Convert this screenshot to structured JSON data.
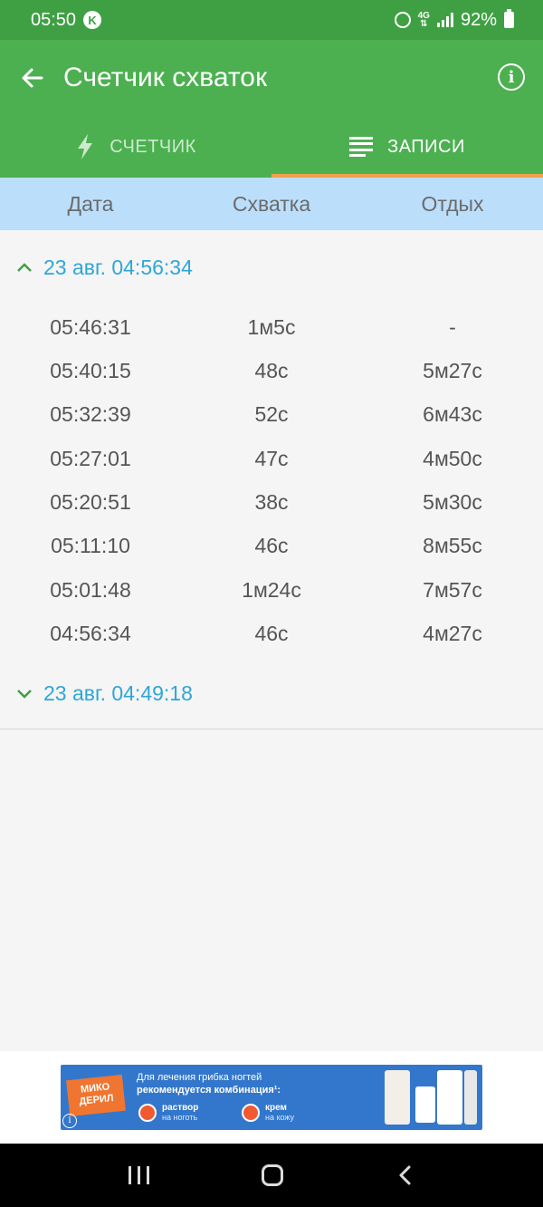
{
  "status_bar": {
    "time": "05:50",
    "carrier_badge": "K",
    "network": "4G",
    "battery": "92%"
  },
  "app_bar": {
    "title": "Счетчик схваток",
    "icons": [
      "back-arrow-icon",
      "info-icon"
    ]
  },
  "tabs": [
    {
      "label": "СЧЕТЧИК",
      "icon": "lightning-bolt-icon",
      "active": false
    },
    {
      "label": "ЗАПИСИ",
      "icon": "list-lines-icon",
      "active": true
    }
  ],
  "columns": [
    "Дата",
    "Схватка",
    "Отдых"
  ],
  "groups": [
    {
      "title": "23 авг. 04:56:34",
      "expanded": true,
      "records": [
        {
          "time": "05:46:31",
          "contraction": "1м5с",
          "rest": "-"
        },
        {
          "time": "05:40:15",
          "contraction": "48с",
          "rest": "5м27с"
        },
        {
          "time": "05:32:39",
          "contraction": "52с",
          "rest": "6м43с"
        },
        {
          "time": "05:27:01",
          "contraction": "47с",
          "rest": "4м50с"
        },
        {
          "time": "05:20:51",
          "contraction": "38с",
          "rest": "5м30с"
        },
        {
          "time": "05:11:10",
          "contraction": "46с",
          "rest": "8м55с"
        },
        {
          "time": "05:01:48",
          "contraction": "1м24с",
          "rest": "7м57с"
        },
        {
          "time": "04:56:34",
          "contraction": "46с",
          "rest": "4м27с"
        }
      ]
    },
    {
      "title": "23 авг. 04:49:18",
      "expanded": false,
      "records": []
    }
  ],
  "ad": {
    "brand": "МИКО ДЕРИЛ",
    "line1": "Для лечения грибка ногтей",
    "line2": "рекомендуется комбинация¹:",
    "item1_title": "раствор",
    "item1_sub": "на ноготь",
    "item2_title": "крем",
    "item2_sub": "на кожу"
  },
  "colors": {
    "status_bar": "#3fa043",
    "app_bar": "#4cb050",
    "tab_indicator": "#f0a050",
    "column_header": "#bbdefb",
    "group_title": "#2ea6d8",
    "body_text": "#555555"
  }
}
